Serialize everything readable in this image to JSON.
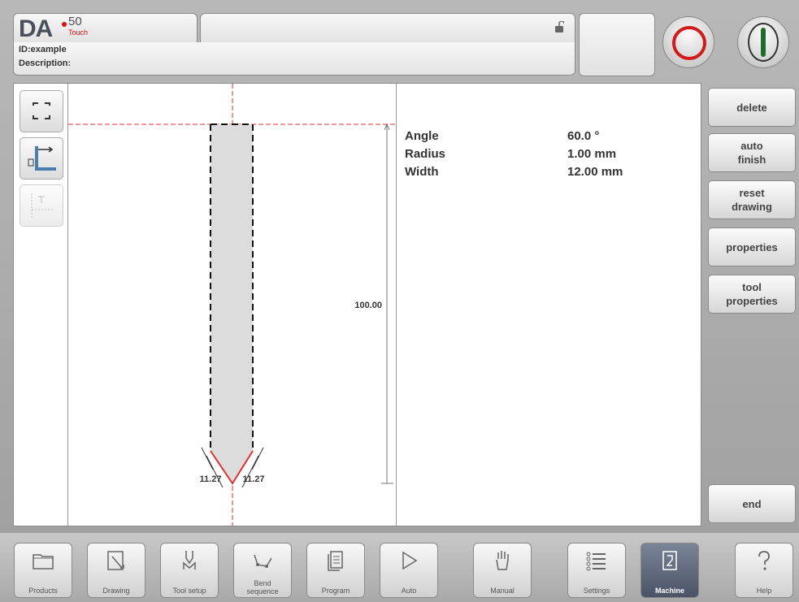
{
  "header": {
    "logo_brand": "DA",
    "logo_model": "50",
    "logo_sub": "Touch",
    "id_line": "ID:example",
    "description_line": "Description:"
  },
  "properties": [
    {
      "label": "Angle",
      "value": "60.0 °"
    },
    {
      "label": "Radius",
      "value": "1.00 mm"
    },
    {
      "label": "Width",
      "value": "12.00 mm"
    }
  ],
  "drawing": {
    "height_dim": "100.00",
    "left_dim": "11.27",
    "right_dim": "11.27"
  },
  "side_buttons": [
    "delete",
    "auto\nfinish",
    "reset\ndrawing",
    "properties",
    "tool\nproperties",
    "end"
  ],
  "nav": [
    {
      "label": "Products",
      "icon": "folder-icon"
    },
    {
      "label": "Drawing",
      "icon": "pencil-icon"
    },
    {
      "label": "Tool setup",
      "icon": "tool-icon"
    },
    {
      "label": "Bend\nsequence",
      "icon": "bend-icon"
    },
    {
      "label": "Program",
      "icon": "pages-icon"
    },
    {
      "label": "Auto",
      "icon": "play-icon"
    },
    {
      "label": "Manual",
      "icon": "hand-icon"
    },
    {
      "label": "Settings",
      "icon": "list-icon"
    },
    {
      "label": "Machine",
      "icon": "machine-icon",
      "active": true
    },
    {
      "label": "Help",
      "icon": "help-icon"
    }
  ],
  "colors": {
    "stop": "#d21a1a",
    "start": "#1f6b2a",
    "accent_line": "#e03030"
  }
}
